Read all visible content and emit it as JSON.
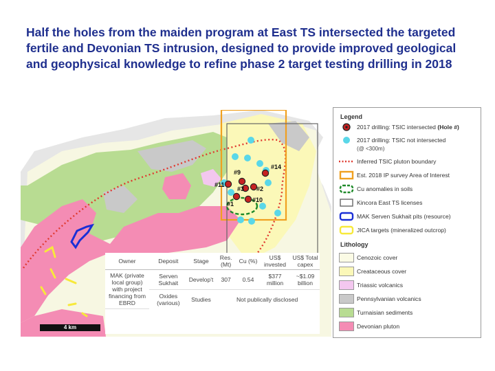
{
  "title": "Half the holes from the maiden program at East TS intersected the targeted fertile and Devonian TS intrusion, designed to provide improved geological and geophysical knowledge to refine phase 2 target testing drilling in 2018",
  "legend": {
    "heading": "Legend",
    "items": [
      {
        "icon": "red-dot-icon",
        "label": "2017 drilling: TSIC intersected (Hole #)",
        "label_main": "2017 drilling: TSIC intersected",
        "label_bold": "(Hole #)"
      },
      {
        "icon": "cyan-dot-icon",
        "label": "2017 drilling: TSIC not intersected",
        "sub": "(@ <300m)"
      },
      {
        "icon": "dotted-red-line-icon",
        "label": "Inferred TSIC pluton boundary"
      },
      {
        "icon": "orange-box-icon",
        "label": "Est. 2018 IP survey Area of Interest"
      },
      {
        "icon": "green-dashed-box-icon",
        "label": "Cu anomalies in soils"
      },
      {
        "icon": "grey-box-icon",
        "label": "Kincora East TS licenses"
      },
      {
        "icon": "blue-box-icon",
        "label": "MAK Serven Sukhait pits (resource)"
      },
      {
        "icon": "yellow-box-icon",
        "label": "JICA targets (mineralized outcrop)"
      }
    ],
    "lithology_heading": "Lithology",
    "lithology": [
      {
        "label": "Cenozoic cover",
        "color": "#fbfbe5"
      },
      {
        "label": "Creataceous cover",
        "color": "#fbf8b8"
      },
      {
        "label": "Triassic volcanics",
        "color": "#f3c7ef"
      },
      {
        "label": "Pennsylvanian volcanics",
        "color": "#c9c9c9"
      },
      {
        "label": "Turnaisian sediments",
        "color": "#b8dc92"
      },
      {
        "label": "Devonian pluton",
        "color": "#f48cb4"
      }
    ]
  },
  "holes": [
    {
      "label": "#14",
      "type": "intersected"
    },
    {
      "label": "#9",
      "type": "intersected"
    },
    {
      "label": "#11",
      "type": "intersected"
    },
    {
      "label": "#3",
      "type": "intersected"
    },
    {
      "label": "#2",
      "type": "intersected"
    },
    {
      "label": "#1",
      "type": "intersected"
    },
    {
      "label": "#10",
      "type": "intersected"
    }
  ],
  "table": {
    "headers": [
      "Owner",
      "Deposit",
      "Stage",
      "Res. (Mt)",
      "Cu (%)",
      "US$ invested",
      "US$ Total capex"
    ],
    "rows": [
      [
        "MAK (private local group) with project financing from EBRD",
        "Serven Sukhait",
        "Develop't",
        "307",
        "0.54",
        "$377 million",
        "~$1.09 billion"
      ],
      [
        "",
        "Oxides (various)",
        "Studies",
        "Not publically disclosed"
      ]
    ]
  },
  "scale_bar": "4 km",
  "colors": {
    "title": "#1f2f8e",
    "pluton": "#f48cb4",
    "sediments": "#b8dc92",
    "cretaceous": "#fbf8b8",
    "boundary": "#e0392f",
    "ip_box": "#f0a020",
    "cu_anomaly": "#1f8a2a",
    "cyan_hole": "#5ad7e8"
  }
}
